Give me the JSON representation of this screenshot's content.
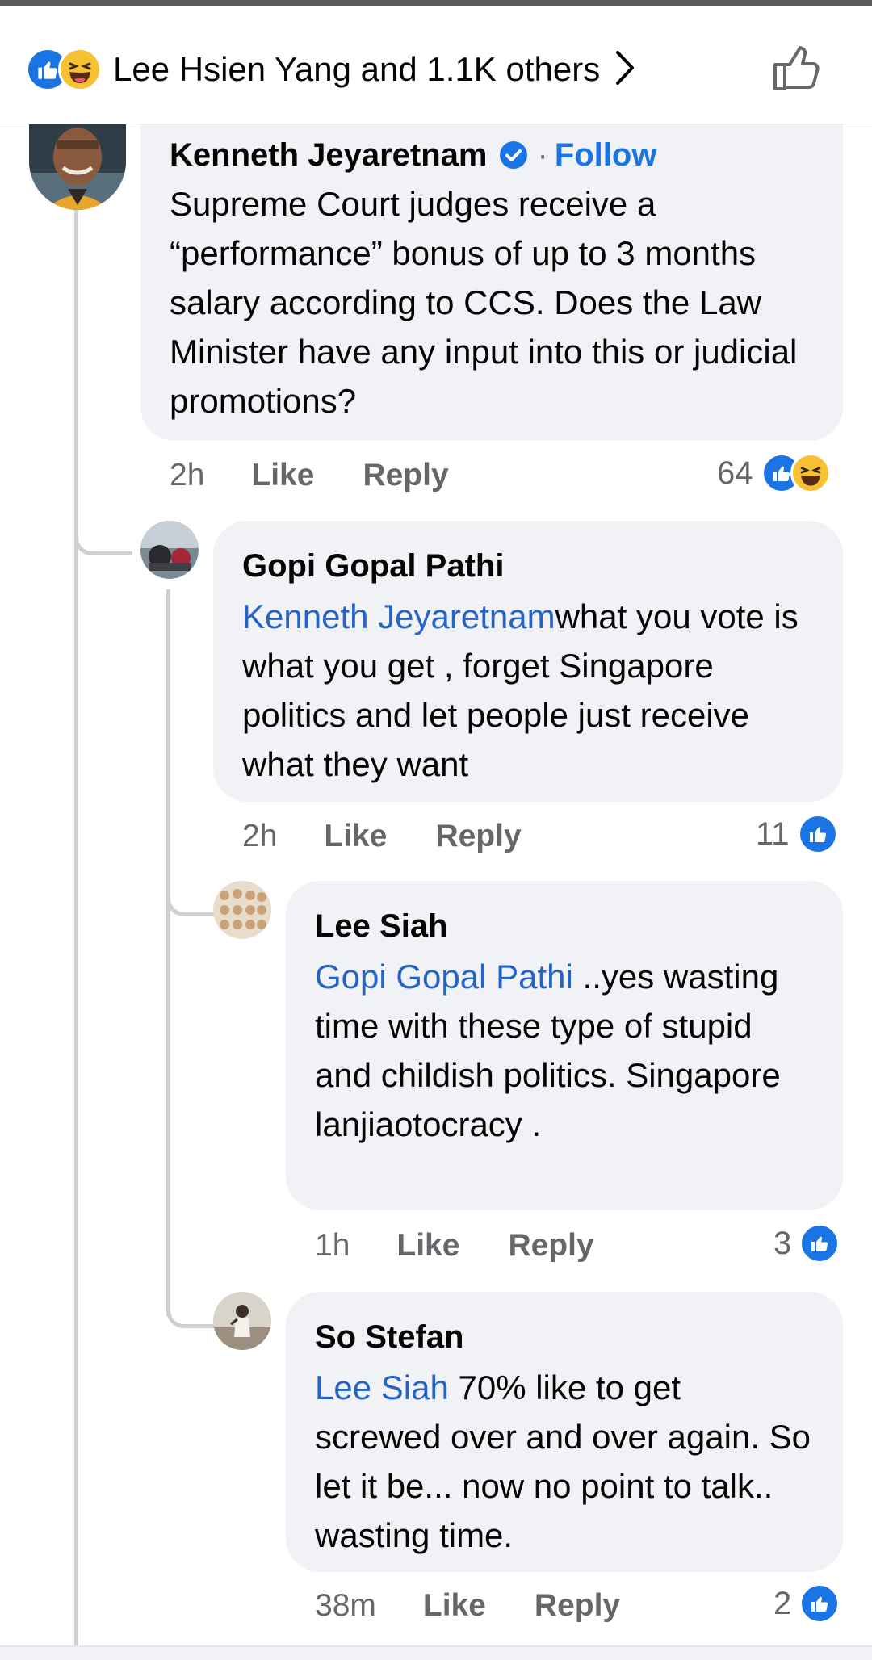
{
  "header": {
    "reaction_summary": "Lee Hsien Yang and 1.1K others",
    "reaction_icons": [
      "like-icon",
      "haha-icon"
    ]
  },
  "comments": [
    {
      "author": "Kenneth Jeyaretnam",
      "verified": true,
      "follow_label": "Follow",
      "separator": "·",
      "text": "Supreme Court judges receive a “performance” bonus of up to 3 months salary according to CCS. Does the Law Minister have any input into this or judicial promotions?",
      "time": "2h",
      "like_label": "Like",
      "reply_label": "Reply",
      "reaction_count": "64",
      "reactions": [
        "like-icon",
        "haha-icon"
      ]
    },
    {
      "author": "Gopi Gopal Pathi",
      "mention": "Kenneth Jeyaretnam",
      "text": "what you vote is what you get , forget Singapore politics and let people just receive what they want",
      "time": "2h",
      "like_label": "Like",
      "reply_label": "Reply",
      "reaction_count": "11",
      "reactions": [
        "like-icon"
      ]
    },
    {
      "author": "Lee Siah",
      "mention": "Gopi Gopal Pathi",
      "text": " ..yes wasting time with these type of stupid and childish politics. Singapore lanjiaotocracy .",
      "time": "1h",
      "like_label": "Like",
      "reply_label": "Reply",
      "reaction_count": "3",
      "reactions": [
        "like-icon"
      ]
    },
    {
      "author": "So Stefan",
      "mention": "Lee Siah",
      "text": " 70% like to get screwed over and over again. So let it be... now no point to talk.. wasting time.",
      "time": "38m",
      "like_label": "Like",
      "reply_label": "Reply",
      "reaction_count": "2",
      "reactions": [
        "like-icon"
      ]
    }
  ],
  "colors": {
    "accent": "#1b74e4",
    "mention": "#2563c4",
    "bubble": "#f0f2f5",
    "meta": "#65676b",
    "haha": "#f7c133"
  }
}
